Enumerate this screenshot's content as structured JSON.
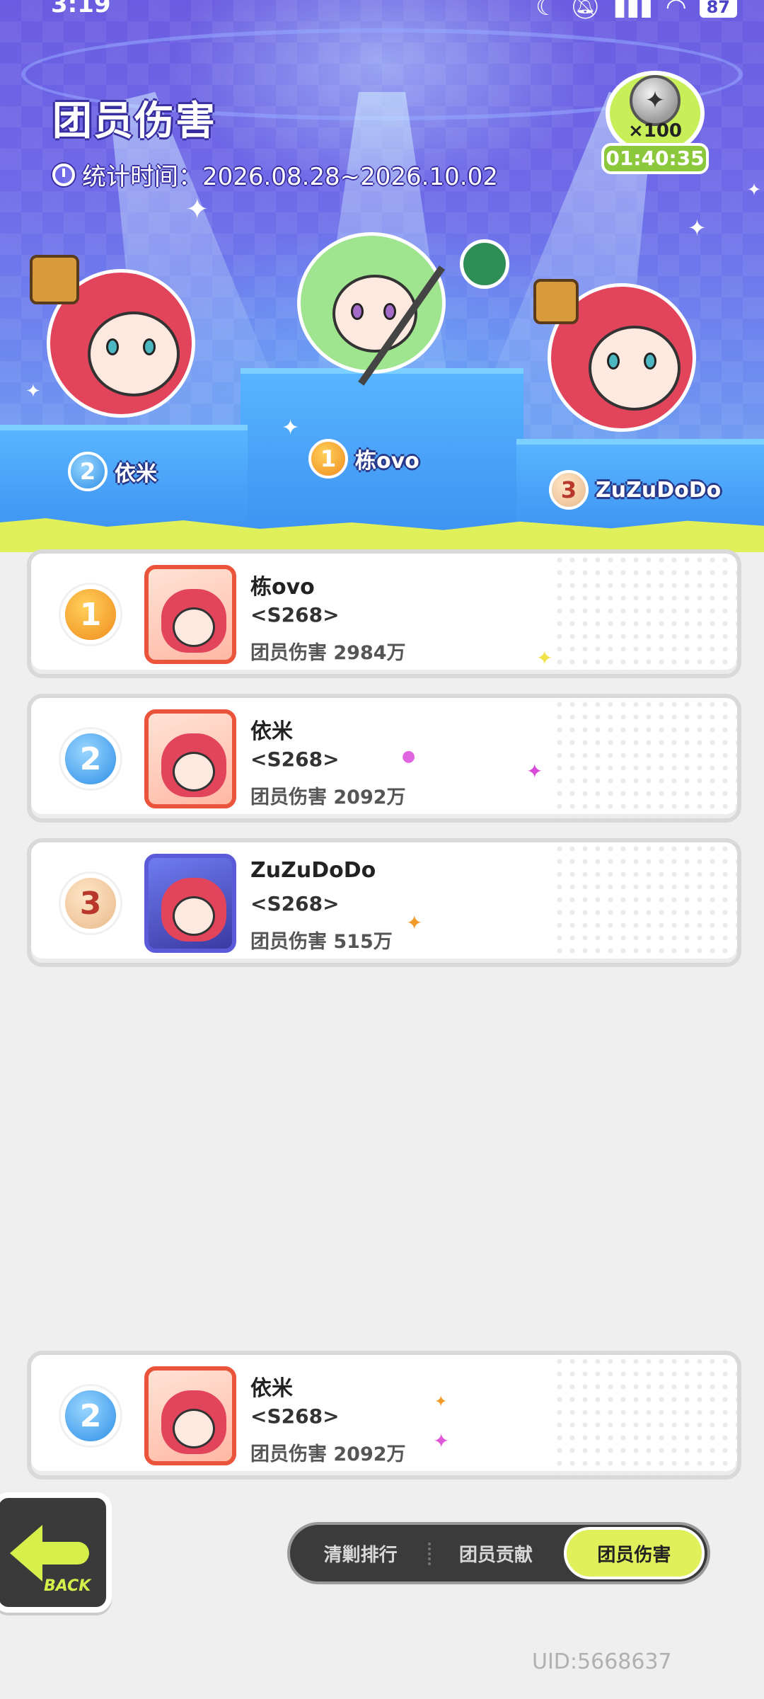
{
  "status_bar": {
    "time": "3:19",
    "battery": "87"
  },
  "header": {
    "title": "团员伤害",
    "period_label": "统计时间：2026.08.28~2026.10.02",
    "reward": {
      "quantity": "×100",
      "countdown": "01:40:35"
    }
  },
  "podium": [
    {
      "rank": "2",
      "name": "依米"
    },
    {
      "rank": "1",
      "name": "栋ovo"
    },
    {
      "rank": "3",
      "name": "ZuZuDoDo"
    }
  ],
  "rankings": [
    {
      "rank": "1",
      "name": "栋ovo",
      "server": "<S268>",
      "stat": "团员伤害 2984万"
    },
    {
      "rank": "2",
      "name": "依米",
      "server": "<S268>",
      "stat": "团员伤害 2092万"
    },
    {
      "rank": "3",
      "name": "ZuZuDoDo",
      "server": "<S268>",
      "stat": "团员伤害 515万"
    }
  ],
  "self_entry": {
    "rank": "2",
    "name": "依米",
    "server": "<S268>",
    "stat": "团员伤害 2092万"
  },
  "back_button": {
    "label": "BACK"
  },
  "tabs": [
    {
      "label": "清剿排行",
      "active": false
    },
    {
      "label": "团员贡献",
      "active": false
    },
    {
      "label": "团员伤害",
      "active": true
    }
  ],
  "uid": "UID:5668637",
  "colors": {
    "accent": "#dff05a",
    "stage_top": "#6a5ce0",
    "stage_bottom": "#7ab6f2",
    "tab_bg": "#3b3b3b"
  },
  "icons": [
    "clock-icon",
    "coin-icon",
    "back-arrow-icon",
    "rank-medal-icon",
    "sparkle-icon",
    "wifi-icon",
    "signal-icon",
    "moon-icon",
    "mute-icon"
  ]
}
